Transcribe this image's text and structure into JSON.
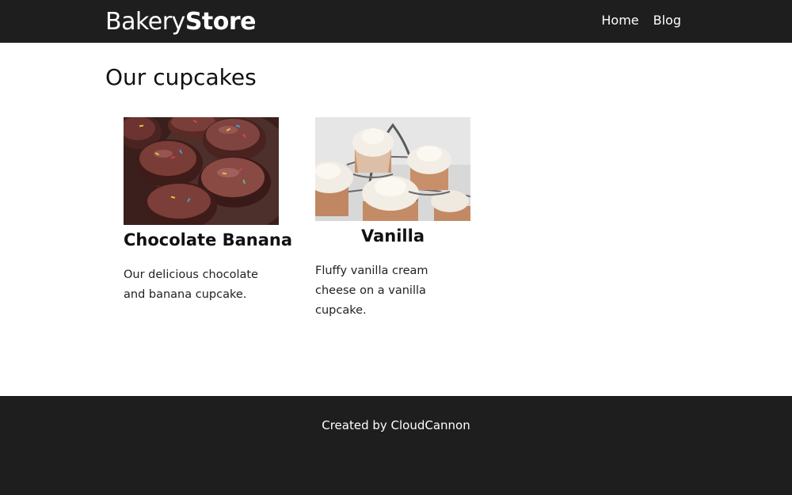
{
  "header": {
    "logo_light": "Bakery",
    "logo_bold": "Store",
    "nav": [
      {
        "label": "Home"
      },
      {
        "label": "Blog"
      }
    ]
  },
  "main": {
    "title": "Our cupcakes",
    "products": [
      {
        "name": "Chocolate Banana",
        "description": "Our delicious chocolate and banana cupcake."
      },
      {
        "name": "Vanilla",
        "description": "Fluffy vanilla cream cheese on a vanilla cupcake."
      }
    ]
  },
  "footer": {
    "text": "Created by CloudCannon"
  }
}
